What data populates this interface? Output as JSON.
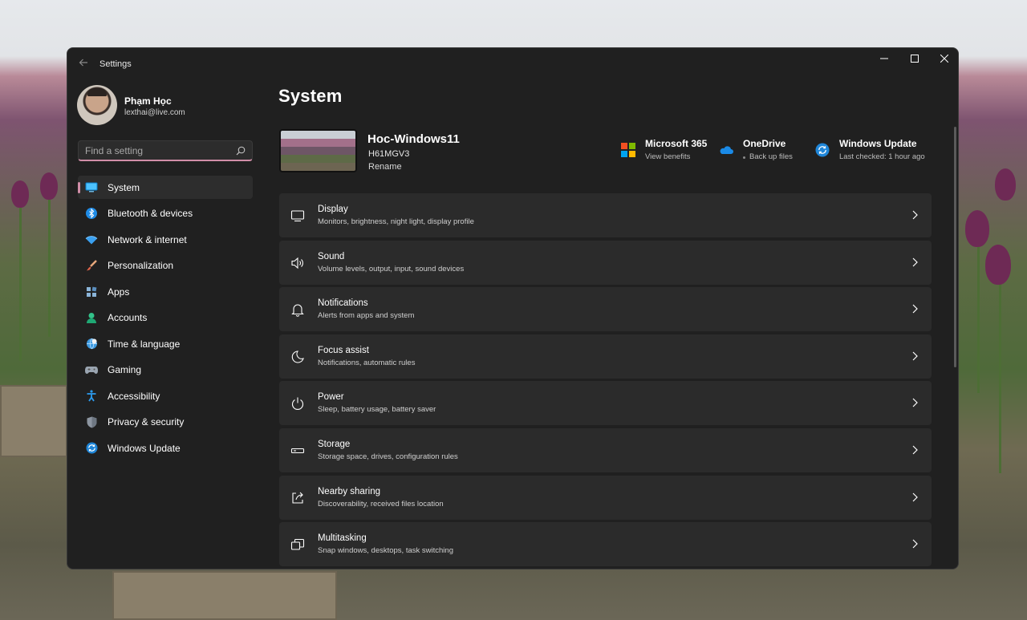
{
  "window": {
    "title": "Settings",
    "controls": [
      "minimize",
      "maximize",
      "close"
    ]
  },
  "profile": {
    "name": "Phạm Học",
    "email": "lexthai@live.com"
  },
  "search": {
    "placeholder": "Find a setting"
  },
  "sidebar": {
    "accent": "#d18ea8",
    "items": [
      {
        "label": "System",
        "icon": "system-icon",
        "active": true
      },
      {
        "label": "Bluetooth & devices",
        "icon": "bluetooth-icon"
      },
      {
        "label": "Network & internet",
        "icon": "wifi-icon"
      },
      {
        "label": "Personalization",
        "icon": "brush-icon"
      },
      {
        "label": "Apps",
        "icon": "apps-icon"
      },
      {
        "label": "Accounts",
        "icon": "person-icon"
      },
      {
        "label": "Time & language",
        "icon": "globe-clock-icon"
      },
      {
        "label": "Gaming",
        "icon": "gamepad-icon"
      },
      {
        "label": "Accessibility",
        "icon": "accessibility-icon"
      },
      {
        "label": "Privacy & security",
        "icon": "shield-icon"
      },
      {
        "label": "Windows Update",
        "icon": "update-icon"
      }
    ]
  },
  "main": {
    "title": "System",
    "device": {
      "name": "Hoc-Windows11",
      "model": "H61MGV3",
      "rename": "Rename"
    },
    "quick_links": [
      {
        "title": "Microsoft 365",
        "subtitle": "View benefits",
        "icon": "microsoft-365-icon"
      },
      {
        "title": "OneDrive",
        "subtitle": "Back up files",
        "icon": "onedrive-icon"
      },
      {
        "title": "Windows Update",
        "subtitle": "Last checked: 1 hour ago",
        "icon": "windows-update-icon"
      }
    ],
    "settings": [
      {
        "title": "Display",
        "subtitle": "Monitors, brightness, night light, display profile",
        "icon": "display-icon"
      },
      {
        "title": "Sound",
        "subtitle": "Volume levels, output, input, sound devices",
        "icon": "speaker-icon"
      },
      {
        "title": "Notifications",
        "subtitle": "Alerts from apps and system",
        "icon": "bell-icon"
      },
      {
        "title": "Focus assist",
        "subtitle": "Notifications, automatic rules",
        "icon": "moon-icon"
      },
      {
        "title": "Power",
        "subtitle": "Sleep, battery usage, battery saver",
        "icon": "power-icon"
      },
      {
        "title": "Storage",
        "subtitle": "Storage space, drives, configuration rules",
        "icon": "storage-icon"
      },
      {
        "title": "Nearby sharing",
        "subtitle": "Discoverability, received files location",
        "icon": "share-icon"
      },
      {
        "title": "Multitasking",
        "subtitle": "Snap windows, desktops, task switching",
        "icon": "multitasking-icon"
      }
    ]
  }
}
